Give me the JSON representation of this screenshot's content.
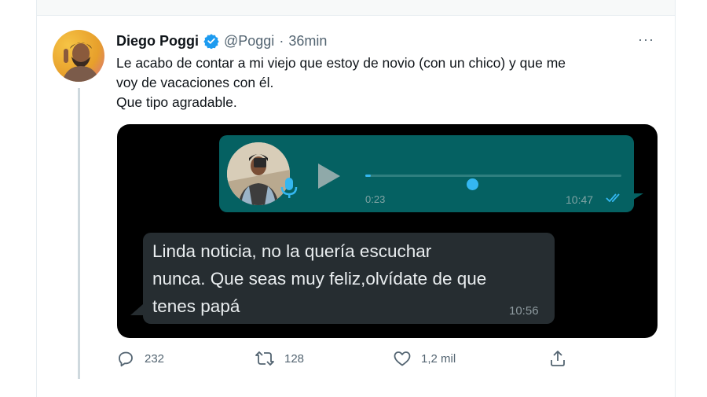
{
  "tweet": {
    "author_name": "Diego Poggi",
    "handle": "@Poggi",
    "separator": "·",
    "time": "36min",
    "more": "···",
    "text_lines": [
      "Le acabo de contar a mi viejo que estoy de novio (con un chico) y que me",
      "voy de vacaciones con él.",
      "Que tipo agradable."
    ]
  },
  "chat": {
    "voice_note": {
      "duration": "0:23",
      "time": "10:47",
      "progress": 0.02
    },
    "reply": {
      "text_lines": [
        "Linda noticia, no la quería escuchar",
        "nunca. Que seas muy feliz,olvídate de que",
        "tenes papá"
      ],
      "time": "10:56"
    }
  },
  "actions": {
    "replies": "232",
    "retweets": "128",
    "likes": "1,2 mil"
  },
  "icons": {
    "verified": "verified-badge-icon",
    "reply": "reply-icon",
    "retweet": "retweet-icon",
    "like": "like-icon",
    "share": "share-icon",
    "play": "play-icon",
    "mic": "microphone-icon",
    "ticks": "double-check-icon"
  },
  "colors": {
    "verified_blue": "#1d9bf0",
    "whatsapp_sent": "#056162",
    "whatsapp_received": "#262d31",
    "progress_blue": "#34b7f1"
  }
}
